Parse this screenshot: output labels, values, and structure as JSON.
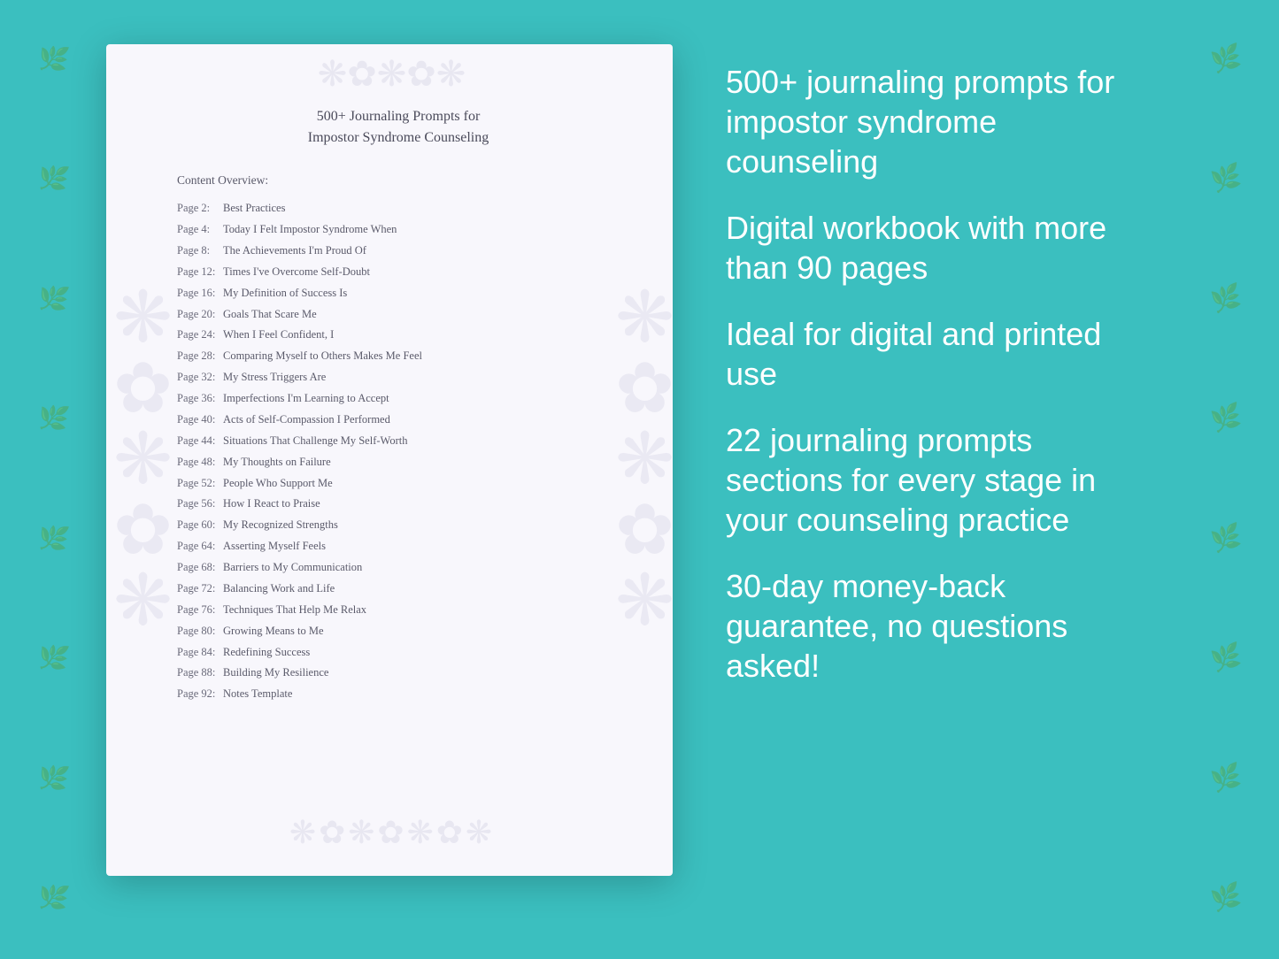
{
  "background_color": "#3bbfbf",
  "document": {
    "title_line1": "500+ Journaling Prompts for",
    "title_line2": "Impostor Syndrome Counseling",
    "content_overview_label": "Content Overview:",
    "toc_items": [
      {
        "page": "Page  2:",
        "title": "Best Practices"
      },
      {
        "page": "Page  4:",
        "title": "Today I Felt Impostor Syndrome When"
      },
      {
        "page": "Page  8:",
        "title": "The Achievements I'm Proud Of"
      },
      {
        "page": "Page 12:",
        "title": "Times I've Overcome Self-Doubt"
      },
      {
        "page": "Page 16:",
        "title": "My Definition of Success Is"
      },
      {
        "page": "Page 20:",
        "title": "Goals That Scare Me"
      },
      {
        "page": "Page 24:",
        "title": "When I Feel Confident, I"
      },
      {
        "page": "Page 28:",
        "title": "Comparing Myself to Others Makes Me Feel"
      },
      {
        "page": "Page 32:",
        "title": "My Stress Triggers Are"
      },
      {
        "page": "Page 36:",
        "title": "Imperfections I'm Learning to Accept"
      },
      {
        "page": "Page 40:",
        "title": "Acts of Self-Compassion I Performed"
      },
      {
        "page": "Page 44:",
        "title": "Situations That Challenge My Self-Worth"
      },
      {
        "page": "Page 48:",
        "title": "My Thoughts on Failure"
      },
      {
        "page": "Page 52:",
        "title": "People Who Support Me"
      },
      {
        "page": "Page 56:",
        "title": "How I React to Praise"
      },
      {
        "page": "Page 60:",
        "title": "My Recognized Strengths"
      },
      {
        "page": "Page 64:",
        "title": "Asserting Myself Feels"
      },
      {
        "page": "Page 68:",
        "title": "Barriers to My Communication"
      },
      {
        "page": "Page 72:",
        "title": "Balancing Work and Life"
      },
      {
        "page": "Page 76:",
        "title": "Techniques That Help Me Relax"
      },
      {
        "page": "Page 80:",
        "title": "Growing Means to Me"
      },
      {
        "page": "Page 84:",
        "title": "Redefining Success"
      },
      {
        "page": "Page 88:",
        "title": "Building My Resilience"
      },
      {
        "page": "Page 92:",
        "title": "Notes Template"
      }
    ]
  },
  "features": [
    "500+ journaling prompts for impostor syndrome counseling",
    "Digital workbook with more than 90 pages",
    "Ideal for digital and printed use",
    "22 journaling prompts sections for every stage in your counseling practice",
    "30-day money-back guarantee, no questions asked!"
  ]
}
